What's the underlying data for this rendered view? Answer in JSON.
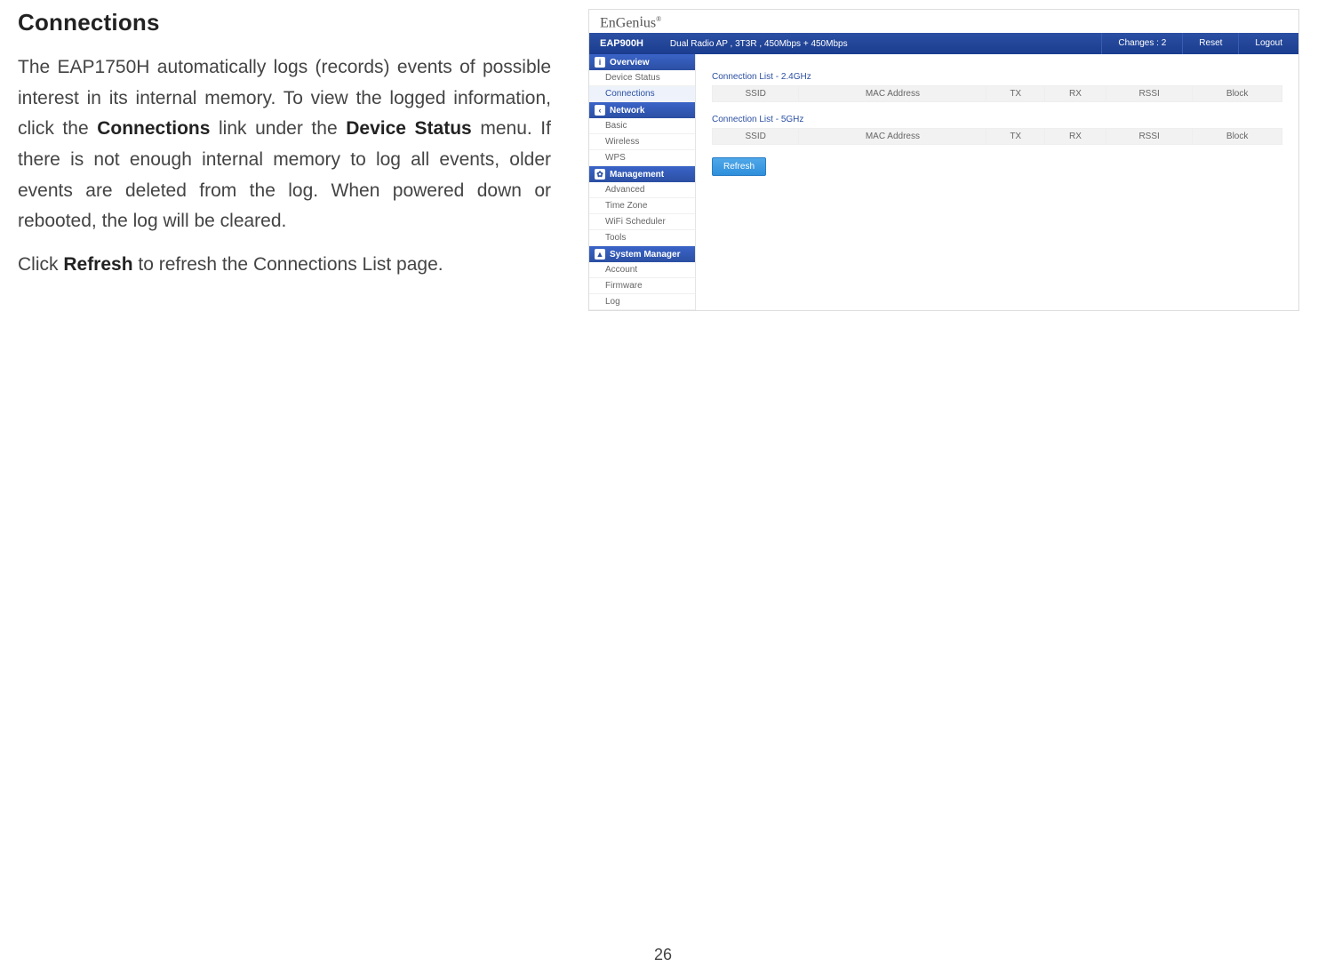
{
  "page": {
    "title": "Connections",
    "number": "26"
  },
  "para1_pre": "The EAP1750H automatically logs (records) events of possible interest in its internal memory. To view the logged information, click the ",
  "para1_b1": "Connections",
  "para1_mid": " link under the ",
  "para1_b2": "Device Status",
  "para1_post": " menu. If there is not enough internal memory to log all events, older events are deleted from the log. When powered down or rebooted, the log will be cleared.",
  "para2_pre": "Click ",
  "para2_b": "Refresh",
  "para2_post": " to refresh the Connections List page.",
  "shot": {
    "brand_pre": "EnGen",
    "brand_mid": "i",
    "brand_post": "us",
    "brand_r": "®",
    "model": "EAP900H",
    "desc": "Dual Radio AP , 3T3R , 450Mbps + 450Mbps",
    "topbtns": {
      "changes": "Changes : 2",
      "reset": "Reset",
      "logout": "Logout"
    },
    "nav": {
      "overview": "Overview",
      "overview_items": [
        "Device Status",
        "Connections"
      ],
      "network": "Network",
      "network_items": [
        "Basic",
        "Wireless",
        "WPS"
      ],
      "management": "Management",
      "management_items": [
        "Advanced",
        "Time Zone",
        "WiFi Scheduler",
        "Tools"
      ],
      "system": "System Manager",
      "system_items": [
        "Account",
        "Firmware",
        "Log"
      ]
    },
    "icons": {
      "info": "i",
      "share": "‹",
      "gear": "✿",
      "user": "▲"
    },
    "main": {
      "list24": "Connection List - 2.4GHz",
      "list5": "Connection List - 5GHz",
      "cols": {
        "ssid": "SSID",
        "mac": "MAC Address",
        "tx": "TX",
        "rx": "RX",
        "rssi": "RSSI",
        "block": "Block"
      },
      "refresh": "Refresh"
    }
  }
}
